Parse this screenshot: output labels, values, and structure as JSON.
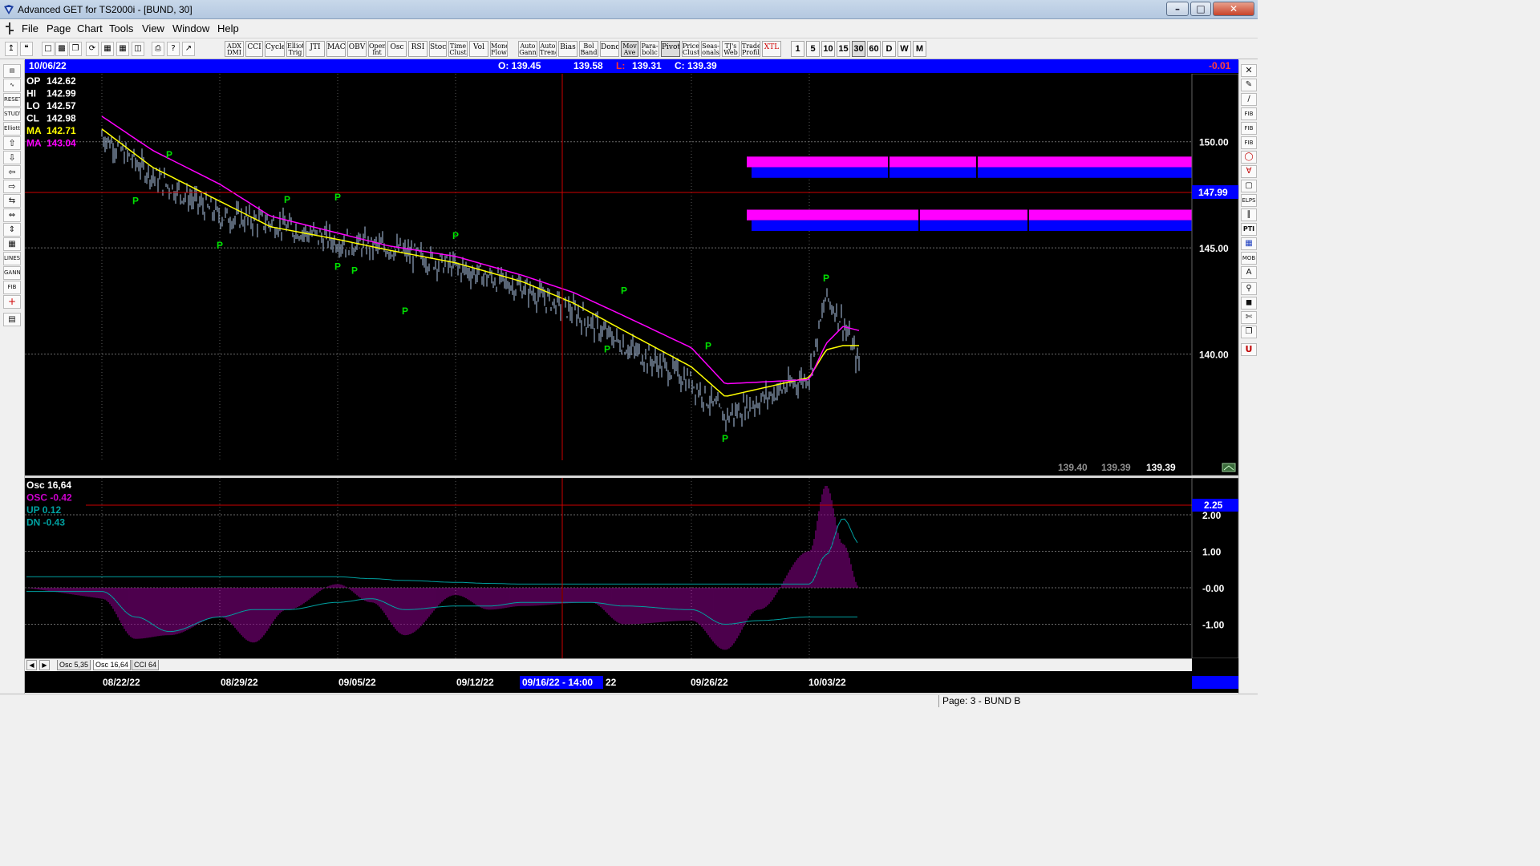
{
  "window": {
    "title": "Advanced GET for TS2000i - [BUND, 30]",
    "minimize": "–",
    "maximize": "□",
    "close": "✕"
  },
  "menu": [
    "File",
    "Page",
    "Chart",
    "Tools",
    "View",
    "Window",
    "Help"
  ],
  "toolbar": {
    "indicators": [
      "ADX DMI",
      "CCI",
      "Cycles",
      "Elliott Trig",
      "JTI",
      "MACD",
      "OBV",
      "Open Int",
      "Osc",
      "RSI",
      "Stoch",
      "Time Clust",
      "Vol",
      "Money Flow"
    ],
    "studies": [
      "Auto Gann",
      "Auto Trend",
      "Bias",
      "Bol Band",
      "Donch",
      "Mov Ave",
      "Para-bolic",
      "Pivot",
      "Price Clust",
      "Seas-onals",
      "TJ's Web",
      "Trade Profile",
      "XTL"
    ],
    "periods": [
      "1",
      "5",
      "10",
      "15",
      "30",
      "60",
      "D",
      "W",
      "M"
    ],
    "active_period": "30"
  },
  "info_bar": {
    "date": "10/06/22",
    "open": "O: 139.45",
    "high": "139.58",
    "low_label": "L:",
    "low": "139.31",
    "close": "C: 139.39",
    "change": "-0.01"
  },
  "price_panel": {
    "legend": [
      {
        "label": "OP",
        "value": "142.62",
        "color": "#ffffff"
      },
      {
        "label": "HI",
        "value": "142.99",
        "color": "#ffffff"
      },
      {
        "label": "LO",
        "value": "142.57",
        "color": "#ffffff"
      },
      {
        "label": "CL",
        "value": "142.98",
        "color": "#ffffff"
      },
      {
        "label": "MA",
        "value": "142.71",
        "color": "#ffff00"
      },
      {
        "label": "MA",
        "value": "143.04",
        "color": "#ff00ff"
      }
    ],
    "axis_labels": [
      "150.00",
      "145.00",
      "140.00"
    ],
    "cursor_price": "147.99",
    "bottom_values": [
      "139.40",
      "139.39",
      "139.39"
    ]
  },
  "osc_panel": {
    "legend": [
      {
        "label": "Osc 16,64",
        "color": "#ffffff"
      },
      {
        "label": "OSC -0.42",
        "color": "#cc00cc"
      },
      {
        "label": "UP  0.12",
        "color": "#00a0a0"
      },
      {
        "label": "DN  -0.43",
        "color": "#00a0a0"
      }
    ],
    "axis_labels": [
      "2.00",
      "1.00",
      "-0.00",
      "-1.00"
    ],
    "cursor_value": "2.25"
  },
  "tabs": [
    "Osc 5,35",
    "Osc 16,64",
    "CCI 64"
  ],
  "active_tab": "Osc 16,64",
  "date_axis": {
    "labels": [
      "08/22/22",
      "08/29/22",
      "09/05/22",
      "09/12/22",
      "09/26/22",
      "10/03/22"
    ],
    "cursor_date": "09/16/22 - 14:00",
    "cursor_tail": "22"
  },
  "status": {
    "page": "Page: 3 - BUND B"
  },
  "chart_data": [
    {
      "type": "line",
      "title": "BUND, 30",
      "x": [
        "08/22/22",
        "08/25/22",
        "08/29/22",
        "09/01/22",
        "09/05/22",
        "09/08/22",
        "09/12/22",
        "09/16/22",
        "09/19/22",
        "09/22/22",
        "09/26/22",
        "09/28/22",
        "10/03/22",
        "10/04/22",
        "10/05/22",
        "10/06/22"
      ],
      "series": [
        {
          "name": "Price",
          "color": "#b0c8e8",
          "values": [
            150.3,
            148.4,
            146.5,
            146.2,
            145.3,
            145.0,
            144.1,
            143.1,
            142.0,
            140.4,
            138.7,
            137.0,
            139.0,
            142.7,
            141.5,
            139.4
          ]
        },
        {
          "name": "MA",
          "color": "#ffff00",
          "values": [
            150.6,
            148.8,
            147.2,
            146.0,
            145.4,
            144.9,
            144.3,
            143.4,
            142.4,
            141.1,
            139.4,
            138.0,
            138.9,
            140.2,
            140.4,
            140.4
          ]
        },
        {
          "name": "MA",
          "color": "#ff00ff",
          "values": [
            151.2,
            149.6,
            148.0,
            146.5,
            145.7,
            145.1,
            144.6,
            143.7,
            142.9,
            141.8,
            140.3,
            138.6,
            138.8,
            140.5,
            141.3,
            141.1
          ]
        }
      ],
      "pivots": [
        {
          "x": "08/24/22",
          "y": 147.6,
          "side": "low"
        },
        {
          "x": "08/26/22",
          "y": 149.0,
          "side": "high"
        },
        {
          "x": "08/29/22",
          "y": 145.5,
          "side": "low"
        },
        {
          "x": "09/02/22",
          "y": 146.9,
          "side": "high"
        },
        {
          "x": "09/05/22",
          "y": 144.5,
          "side": "low"
        },
        {
          "x": "09/05/22",
          "y": 147.0,
          "side": "high"
        },
        {
          "x": "09/06/22",
          "y": 144.3,
          "side": "low"
        },
        {
          "x": "09/09/22",
          "y": 142.4,
          "side": "low"
        },
        {
          "x": "09/12/22",
          "y": 145.2,
          "side": "high"
        },
        {
          "x": "09/21/22",
          "y": 140.6,
          "side": "low"
        },
        {
          "x": "09/22/22",
          "y": 142.6,
          "side": "high"
        },
        {
          "x": "09/27/22",
          "y": 140.0,
          "side": "high"
        },
        {
          "x": "09/28/22",
          "y": 136.4,
          "side": "low"
        },
        {
          "x": "10/04/22",
          "y": 143.2,
          "side": "high"
        }
      ],
      "zones": [
        {
          "name": "upper",
          "top": 149.3,
          "bottom": 148.3
        },
        {
          "name": "lower",
          "top": 146.8,
          "bottom": 145.8
        }
      ],
      "ylim": [
        135.0,
        153.2
      ]
    },
    {
      "type": "bar",
      "title": "Osc 16,64",
      "x": [
        "08/22/22",
        "08/24/22",
        "08/26/22",
        "08/29/22",
        "08/31/22",
        "09/02/22",
        "09/05/22",
        "09/07/22",
        "09/09/22",
        "09/12/22",
        "09/14/22",
        "09/16/22",
        "09/20/22",
        "09/22/22",
        "09/26/22",
        "09/28/22",
        "09/30/22",
        "10/03/22",
        "10/04/22",
        "10/05/22",
        "10/06/22"
      ],
      "series": [
        {
          "name": "OSC",
          "color": "#800080",
          "values": [
            -0.3,
            -1.4,
            -1.3,
            -0.8,
            -1.5,
            -0.6,
            0.1,
            -0.4,
            -1.3,
            -0.2,
            -0.6,
            -0.5,
            -0.4,
            -1.0,
            -0.9,
            -1.7,
            -0.6,
            1.0,
            2.8,
            1.2,
            0.0
          ]
        },
        {
          "name": "UP",
          "color": "#00a0a0",
          "values": [
            0.3,
            0.3,
            0.3,
            0.3,
            0.3,
            0.3,
            0.3,
            0.25,
            0.2,
            0.15,
            0.12,
            0.1,
            0.1,
            0.1,
            0.1,
            0.1,
            0.1,
            0.1,
            0.9,
            1.9,
            1.2
          ]
        },
        {
          "name": "DN",
          "color": "#00a0a0",
          "values": [
            -0.1,
            -0.8,
            -1.2,
            -0.8,
            -0.6,
            -0.6,
            -0.4,
            -0.3,
            -0.6,
            -0.5,
            -0.5,
            -0.4,
            -0.4,
            -0.5,
            -0.6,
            -1.0,
            -0.9,
            -0.8,
            -0.8,
            -0.8,
            -0.8
          ]
        }
      ],
      "ylim": [
        -2.0,
        2.8
      ]
    }
  ]
}
